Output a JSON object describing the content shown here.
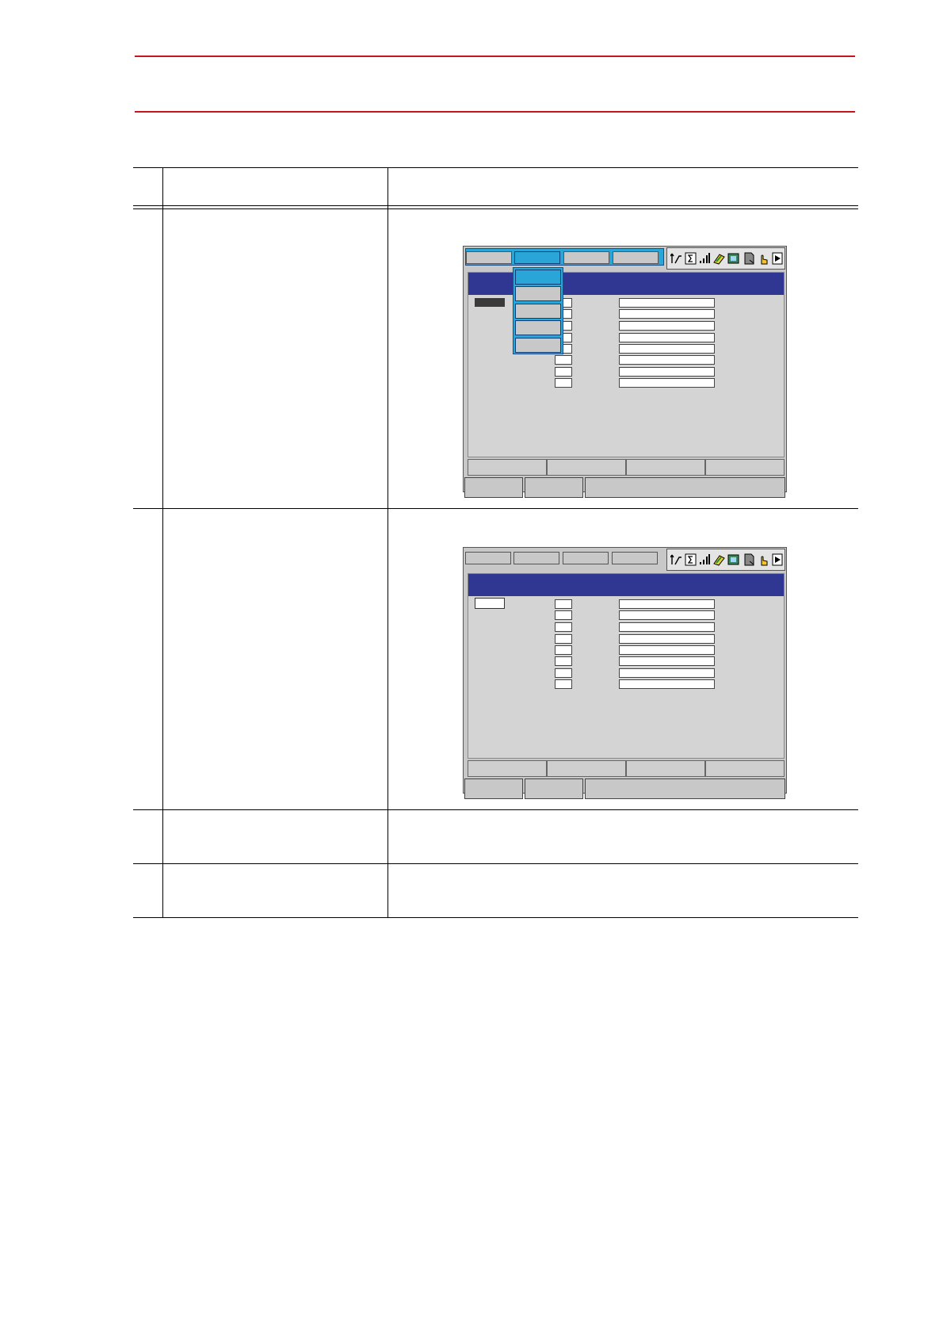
{
  "document": {
    "rows": [
      {
        "id": "header"
      },
      {
        "id": "step-a"
      },
      {
        "id": "step-b"
      },
      {
        "id": "step-c"
      },
      {
        "id": "step-d"
      }
    ]
  },
  "colors": {
    "rule": "#c4161c",
    "title_bar": "#303793",
    "active_menu": "#2aa5d8",
    "panel_gray": "#c8c8c8"
  },
  "screens": [
    {
      "id": "screen-1",
      "menu_open": true,
      "menu_tabs": 4,
      "dropdown_items": 5,
      "selected_dropdown_item": 1,
      "small_boxes": 8,
      "large_boxes": 8,
      "function_keys": 4
    },
    {
      "id": "screen-2",
      "menu_open": false,
      "menu_tabs": 4,
      "dropdown_items": 0,
      "small_boxes": 8,
      "large_boxes": 8,
      "function_keys": 4
    }
  ],
  "status_icons": [
    "axis-icon",
    "sigma-icon",
    "signal-icon",
    "tool-icon",
    "monitor-icon",
    "document-icon",
    "hand-icon",
    "play-icon"
  ]
}
